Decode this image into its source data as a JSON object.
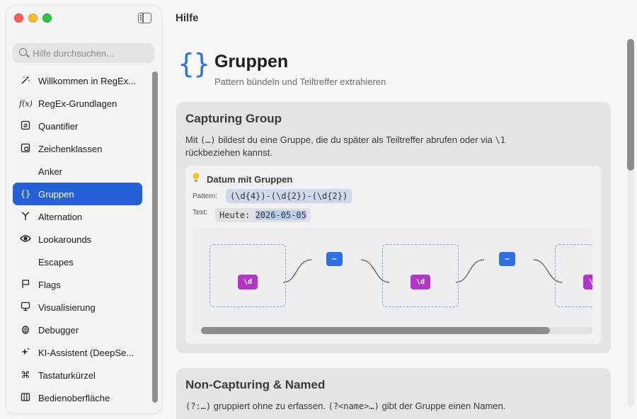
{
  "sidebar": {
    "search_placeholder": "Hilfe durchsuchen...",
    "items": [
      {
        "icon": "sparkle-wand-icon",
        "glyph": "⚡",
        "label": "Willkommen in RegEx..."
      },
      {
        "icon": "function-icon",
        "glyph": "f(x)",
        "label": "RegEx-Grundlagen"
      },
      {
        "icon": "number-square-icon",
        "glyph": "#",
        "label": "Quantifier"
      },
      {
        "icon": "character-class-icon",
        "glyph": "◫",
        "label": "Zeichenklassen"
      },
      {
        "icon": "",
        "glyph": "",
        "label": "Anker"
      },
      {
        "icon": "braces-icon",
        "glyph": "{}",
        "label": "Gruppen"
      },
      {
        "icon": "branch-icon",
        "glyph": "Y",
        "label": "Alternation"
      },
      {
        "icon": "eye-icon",
        "glyph": "◉",
        "label": "Lookarounds"
      },
      {
        "icon": "",
        "glyph": "",
        "label": "Escapes"
      },
      {
        "icon": "flag-icon",
        "glyph": "⚑",
        "label": "Flags"
      },
      {
        "icon": "monitor-icon",
        "glyph": "▭",
        "label": "Visualisierung"
      },
      {
        "icon": "ladybug-icon",
        "glyph": "✺",
        "label": "Debugger"
      },
      {
        "icon": "sparkles-icon",
        "glyph": "✦",
        "label": "KI-Assistent (DeepSe..."
      },
      {
        "icon": "command-icon",
        "glyph": "⌘",
        "label": "Tastaturkürzel"
      },
      {
        "icon": "layout-icon",
        "glyph": "▥",
        "label": "Bedienoberfläche"
      }
    ]
  },
  "header": {
    "title": "Hilfe"
  },
  "page": {
    "icon": "braces-icon",
    "icon_glyph": "{}",
    "title": "Gruppen",
    "subtitle": "Pattern bündeln und Teiltreffer extrahieren"
  },
  "card1": {
    "title": "Capturing Group",
    "text_a": "Mit ",
    "code_a": "(…)",
    "text_b": " bildest du eine Gruppe, die du später als Teiltreffer abrufen oder via ",
    "code_b": "\\1",
    "text_c": "rückbeziehen kannst.",
    "example": {
      "title": "Datum mit Gruppen",
      "pattern_label": "Pattern:",
      "pattern": "(\\d{4})-(\\d{2})-(\\d{2})",
      "text_label": "Text:",
      "text_prefix": "Heute: ",
      "text_match": "2026-05-05",
      "diagram": {
        "token_digit": "\\d",
        "token_dash": "–"
      }
    }
  },
  "card2": {
    "title": "Non-Capturing & Named",
    "code_a": "(?:…)",
    "text_a": " gruppiert ohne zu erfassen. ",
    "code_b": "(?<name>…)",
    "text_b": " gibt der Gruppe einen Namen."
  }
}
